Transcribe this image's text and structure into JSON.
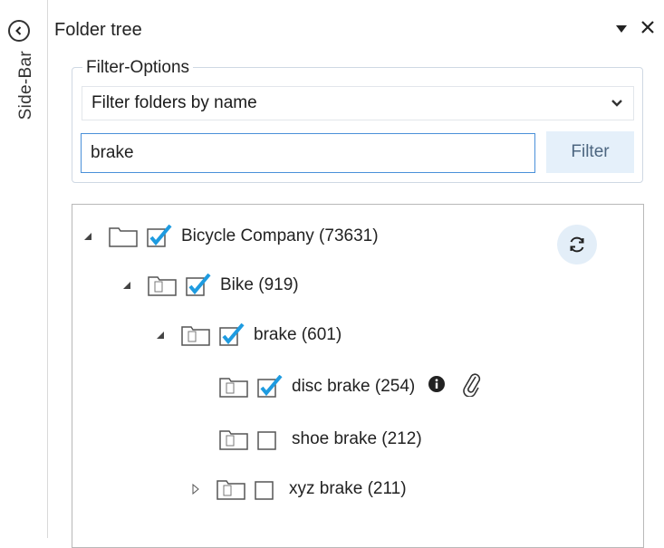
{
  "sidebar": {
    "label": "Side-Bar",
    "collapse_icon": "chevron-left-icon"
  },
  "panel": {
    "title": "Folder tree",
    "dropdown_icon": "triangle-down-icon",
    "close_icon": "close-icon"
  },
  "filter_options": {
    "legend": "Filter-Options",
    "mode_selected": "Filter folders by name",
    "search_value": "brake",
    "filter_button": "Filter"
  },
  "tree": {
    "refresh_icon": "refresh-icon",
    "rows": [
      {
        "label": "Bicycle Company (73631)",
        "expanded": true,
        "checked": true
      },
      {
        "label": "Bike (919)",
        "expanded": true,
        "checked": true
      },
      {
        "label": "brake (601)",
        "expanded": true,
        "checked": true
      },
      {
        "label": "disc brake (254)",
        "checked": true,
        "info_icon": "info-icon",
        "attachment_icon": "paperclip-icon"
      },
      {
        "label": "shoe brake (212)",
        "checked": false
      },
      {
        "label": "xyz brake (211)",
        "expanded": false,
        "checked": false
      }
    ]
  },
  "colors": {
    "check": "#1e9be0",
    "accent": "#4a90d9",
    "button_bg": "#e5f0fa"
  }
}
